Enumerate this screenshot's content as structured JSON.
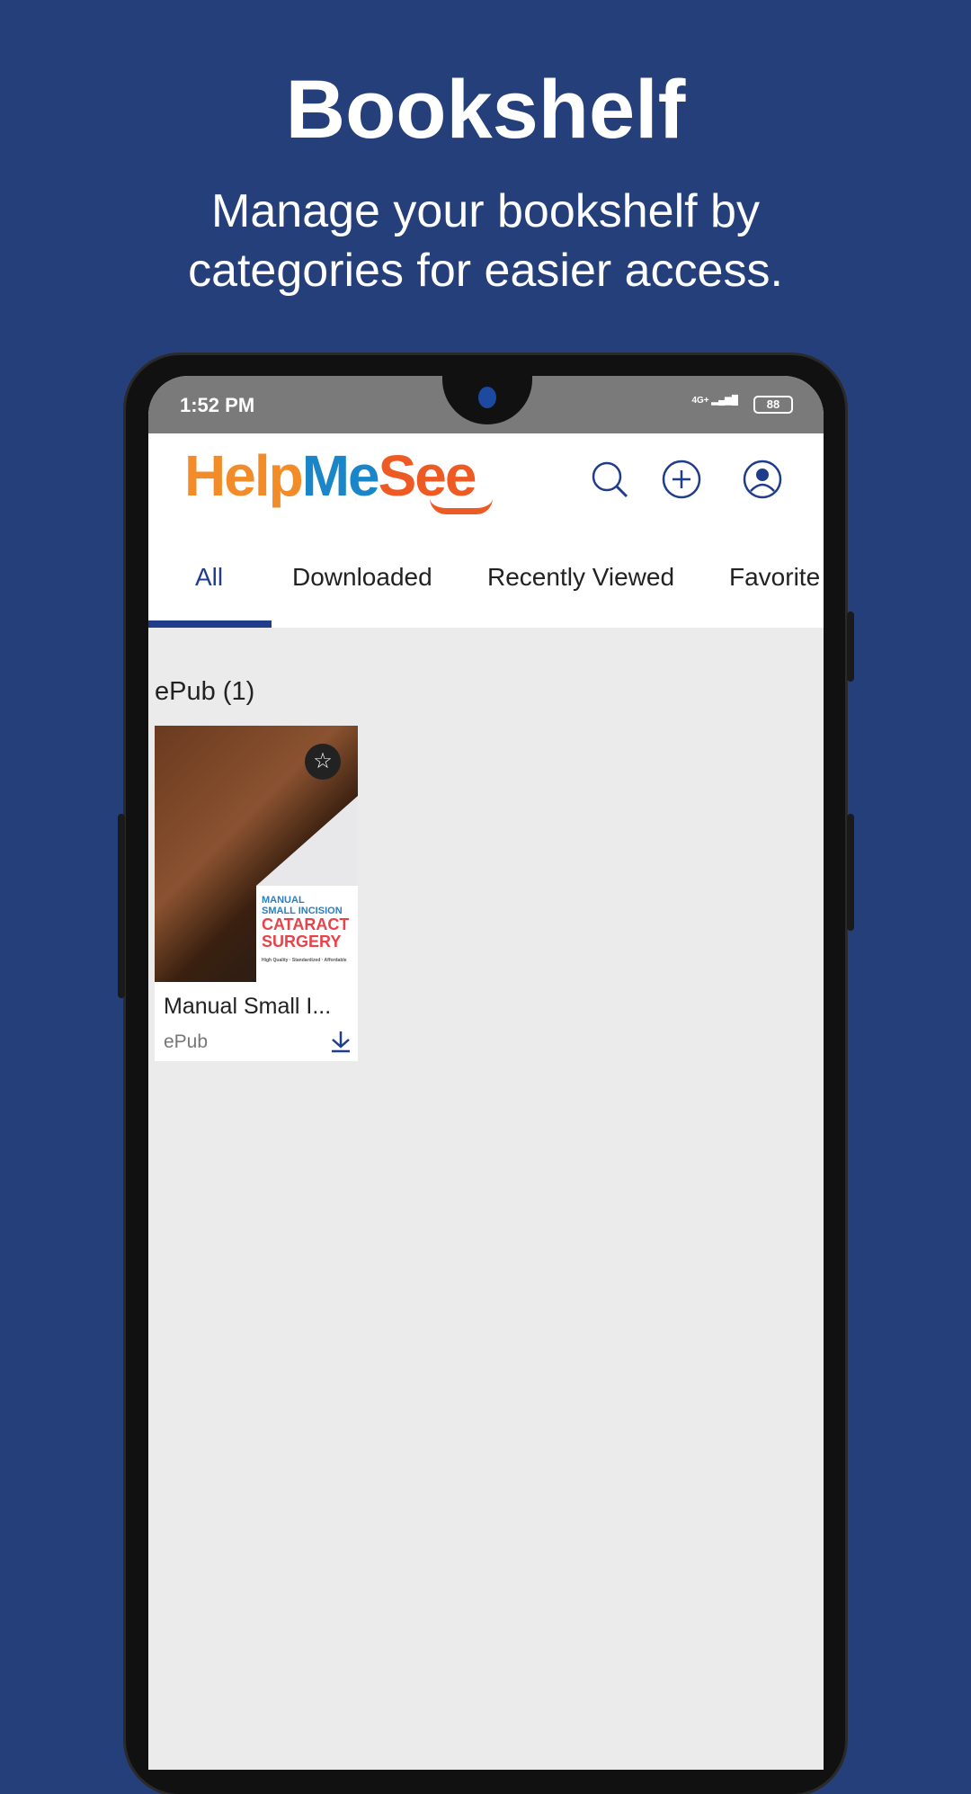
{
  "promo": {
    "title": "Bookshelf",
    "subtitle_line1": "Manage your bookshelf by",
    "subtitle_line2": "categories for easier access."
  },
  "status_bar": {
    "time": "1:52 PM",
    "network": "4G+",
    "battery": "88"
  },
  "app": {
    "logo": {
      "part1": "Help",
      "part2": "Me",
      "part3": "See"
    },
    "icons": [
      "search-icon",
      "plus-circle-icon",
      "profile-icon"
    ]
  },
  "tabs": [
    {
      "label": "All",
      "active": true
    },
    {
      "label": "Downloaded"
    },
    {
      "label": "Recently Viewed"
    },
    {
      "label": "Favorite"
    }
  ],
  "section": {
    "label": "ePub (1)"
  },
  "books": [
    {
      "title": "Manual Small I...",
      "type": "ePub",
      "cover": {
        "line1": "MANUAL",
        "line2": "SMALL INCISION",
        "line3": "CATARACT",
        "line4": "SURGERY",
        "tagline": "High Quality · Standardized · Affordable"
      }
    }
  ],
  "colors": {
    "background": "#253f7b",
    "accent": "#1f3d8a"
  }
}
